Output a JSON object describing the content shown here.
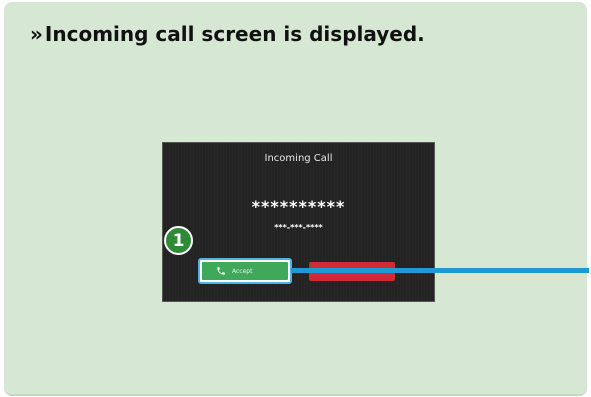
{
  "instruction": {
    "chevron": "»",
    "text": "Incoming call screen is displayed."
  },
  "screen": {
    "title": "Incoming Call",
    "caller_name": "**********",
    "caller_number": "***-***-****",
    "accept_label": "Accept",
    "decline_label": ""
  },
  "callout": {
    "step_number": "1"
  },
  "icons": {
    "accept": "phone-icon"
  },
  "colors": {
    "panel_background": "#d6e8d3",
    "screen_background": "#232323",
    "accept_green": "#3fa85a",
    "decline_red": "#d12a35",
    "highlight_blue": "#1e9ad6",
    "step_badge_green": "#2f8a37"
  }
}
